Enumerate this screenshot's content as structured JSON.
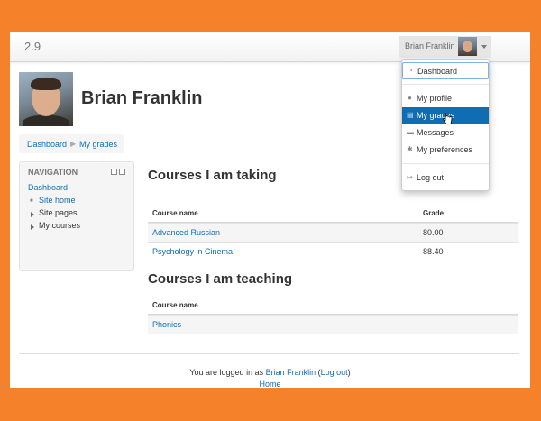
{
  "navbar": {
    "brand": "2.9",
    "user_name": "Brian Franklin"
  },
  "user_menu": {
    "items": [
      {
        "label": "Dashboard",
        "icon": "dashboard-icon"
      },
      {
        "label": "My profile",
        "icon": "user-icon"
      },
      {
        "label": "My grades",
        "icon": "grades-icon"
      },
      {
        "label": "Messages",
        "icon": "message-icon"
      },
      {
        "label": "My preferences",
        "icon": "gear-icon"
      },
      {
        "label": "Log out",
        "icon": "logout-icon"
      }
    ]
  },
  "profile": {
    "full_name": "Brian Franklin"
  },
  "breadcrumb": {
    "items": [
      "Dashboard",
      "My grades"
    ],
    "separator": "▶"
  },
  "navigation": {
    "title": "NAVIGATION",
    "dashboard": "Dashboard",
    "items": [
      "Site home",
      "Site pages",
      "My courses"
    ]
  },
  "taking": {
    "heading": "Courses I am taking",
    "col_course": "Course name",
    "col_grade": "Grade",
    "rows": [
      {
        "course": "Advanced Russian",
        "grade": "80.00"
      },
      {
        "course": "Psychology in Cinema",
        "grade": "88.40"
      }
    ]
  },
  "teaching": {
    "heading": "Courses I am teaching",
    "col_course": "Course name",
    "rows": [
      {
        "course": "Phonics"
      }
    ]
  },
  "footer": {
    "logged_in_prefix": "You are logged in as",
    "user_link": "Brian Franklin",
    "logout_link": "Log out",
    "home_link": "Home"
  },
  "colors": {
    "accent": "#0f6db3",
    "frame": "#f5822a"
  }
}
